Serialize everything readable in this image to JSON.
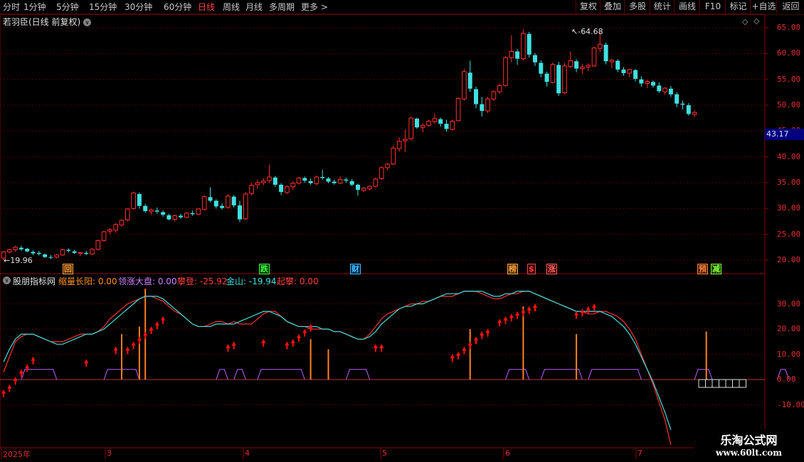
{
  "toolbar": {
    "periods": [
      "分时",
      "1分钟",
      "5分钟",
      "15分钟",
      "30分钟",
      "60分钟",
      "日线",
      "周线",
      "月线",
      "多周期",
      "更多 >"
    ],
    "active_period": "日线",
    "right_buttons": [
      "复权",
      "叠加",
      "多股",
      "统计",
      "画线",
      "F10",
      "标记",
      "+自选",
      "返回"
    ]
  },
  "main_panel": {
    "title": "若羽臣(日线 前复权)",
    "high_label": "64.68",
    "low_label": "19.96",
    "current_price": "43.17",
    "y_axis": [
      "65.00",
      "60.00",
      "55.00",
      "50.00",
      "45.00",
      "40.00",
      "35.00",
      "30.00",
      "25.00",
      "20.00"
    ],
    "events": [
      {
        "text": "回",
        "color": "#ffa040",
        "bg": "#402000"
      },
      {
        "text": "跌",
        "color": "#40ff40",
        "bg": "#003000"
      },
      {
        "text": "财",
        "color": "#40c0ff",
        "bg": "#002040"
      },
      {
        "text": "榜",
        "color": "#ffa040",
        "bg": "#403000"
      },
      {
        "text": "$",
        "color": "#ff4040",
        "bg": "#300000"
      },
      {
        "text": "涨",
        "color": "#ff6060",
        "bg": "#300000"
      },
      {
        "text": "预",
        "color": "#ff8040",
        "bg": "#402000"
      },
      {
        "text": "减",
        "color": "#80ff40",
        "bg": "#203000"
      }
    ]
  },
  "indicator_panel": {
    "title": "股朋指标网",
    "items": [
      {
        "label": "缩量长阳: 0.00",
        "color": "#ff9020"
      },
      {
        "label": "领涨大盘: 0.00",
        "color": "#d080ff"
      },
      {
        "label": "攀登: -25.92",
        "color": "#ff4040"
      },
      {
        "label": "金山: -19.94",
        "color": "#40e0e0"
      },
      {
        "label": "起攀: 0.00",
        "color": "#ff4040"
      }
    ],
    "y_axis": [
      "30.00",
      "20.00",
      "10.00",
      "0.00",
      "-10.00"
    ]
  },
  "date_axis": [
    "2025年",
    "3",
    "4",
    "5",
    "6",
    "7"
  ],
  "watermark": {
    "line1": "乐淘公式网",
    "line2": "www.60lt.com"
  },
  "colors": {
    "up": "#ff3030",
    "down": "#40e0e0",
    "grid": "#5a0000",
    "axis_text": "#e03030"
  },
  "chart_data": {
    "type": "candlestick",
    "candles": [
      [
        20.4,
        21.8,
        20.0,
        21.6
      ],
      [
        21.6,
        22.2,
        21.3,
        22.0
      ],
      [
        22.0,
        22.8,
        21.6,
        22.5
      ],
      [
        22.4,
        22.8,
        21.8,
        22.1
      ],
      [
        22.2,
        22.4,
        21.5,
        21.7
      ],
      [
        21.6,
        21.9,
        21.0,
        21.3
      ],
      [
        21.4,
        21.8,
        20.9,
        21.2
      ],
      [
        21.1,
        21.3,
        20.4,
        20.6
      ],
      [
        20.6,
        21.0,
        20.2,
        20.5
      ],
      [
        20.6,
        21.2,
        20.3,
        21.0
      ],
      [
        21.0,
        22.2,
        20.8,
        22.0
      ],
      [
        22.0,
        22.3,
        21.5,
        21.8
      ],
      [
        21.7,
        22.0,
        21.2,
        21.4
      ],
      [
        21.3,
        21.6,
        20.8,
        21.5
      ],
      [
        21.4,
        21.8,
        21.0,
        21.2
      ],
      [
        21.2,
        22.3,
        21.0,
        22.1
      ],
      [
        22.1,
        24.0,
        21.9,
        23.8
      ],
      [
        23.8,
        25.7,
        23.5,
        25.5
      ],
      [
        25.6,
        26.2,
        25.0,
        25.9
      ],
      [
        25.8,
        27.2,
        25.3,
        26.9
      ],
      [
        26.8,
        28.0,
        26.5,
        27.7
      ],
      [
        27.8,
        30.1,
        27.5,
        29.9
      ],
      [
        30.0,
        33.3,
        29.8,
        33.0
      ],
      [
        32.8,
        33.1,
        30.0,
        30.5
      ],
      [
        30.5,
        30.9,
        29.2,
        29.5
      ],
      [
        29.4,
        30.0,
        28.8,
        29.7
      ],
      [
        29.6,
        30.2,
        29.0,
        29.4
      ],
      [
        29.3,
        29.6,
        28.4,
        28.8
      ],
      [
        28.7,
        29.0,
        27.7,
        27.9
      ],
      [
        27.9,
        28.8,
        27.5,
        28.6
      ],
      [
        28.6,
        29.0,
        28.0,
        28.3
      ],
      [
        28.3,
        29.3,
        28.1,
        29.1
      ],
      [
        29.1,
        29.6,
        28.6,
        28.9
      ],
      [
        28.9,
        30.1,
        28.7,
        29.9
      ],
      [
        29.8,
        32.6,
        29.6,
        32.3
      ],
      [
        32.2,
        34.1,
        31.2,
        31.5
      ],
      [
        31.5,
        31.8,
        30.0,
        30.4
      ],
      [
        30.5,
        31.0,
        29.8,
        30.1
      ],
      [
        30.2,
        32.8,
        30.0,
        32.4
      ],
      [
        32.3,
        32.6,
        30.2,
        30.6
      ],
      [
        30.6,
        31.5,
        27.4,
        27.9
      ],
      [
        28.0,
        33.2,
        27.8,
        32.8
      ],
      [
        32.9,
        35.0,
        32.5,
        34.5
      ],
      [
        34.6,
        35.6,
        33.8,
        35.0
      ],
      [
        35.0,
        35.9,
        34.5,
        35.3
      ],
      [
        35.4,
        38.5,
        34.9,
        36.1
      ],
      [
        36.0,
        36.3,
        34.2,
        34.6
      ],
      [
        34.6,
        34.9,
        32.6,
        33.2
      ],
      [
        33.1,
        34.5,
        32.8,
        34.2
      ],
      [
        34.2,
        35.2,
        33.6,
        34.9
      ],
      [
        34.9,
        36.1,
        34.6,
        35.9
      ],
      [
        35.9,
        36.2,
        35.0,
        35.4
      ],
      [
        35.3,
        35.8,
        34.6,
        34.9
      ],
      [
        34.8,
        36.4,
        34.5,
        36.1
      ],
      [
        36.1,
        37.5,
        35.6,
        35.9
      ],
      [
        35.8,
        36.1,
        34.9,
        35.2
      ],
      [
        35.2,
        35.6,
        34.6,
        34.9
      ],
      [
        34.9,
        36.2,
        34.7,
        35.6
      ],
      [
        35.6,
        36.0,
        35.0,
        35.4
      ],
      [
        35.3,
        35.7,
        34.3,
        34.6
      ],
      [
        34.6,
        34.8,
        32.5,
        33.6
      ],
      [
        33.5,
        34.2,
        33.2,
        33.9
      ],
      [
        33.8,
        34.5,
        33.5,
        34.3
      ],
      [
        34.3,
        36.0,
        34.1,
        35.7
      ],
      [
        35.8,
        38.2,
        35.5,
        37.9
      ],
      [
        37.9,
        38.8,
        37.4,
        38.6
      ],
      [
        38.6,
        42.2,
        38.4,
        41.7
      ],
      [
        41.6,
        43.8,
        41.0,
        43.0
      ],
      [
        43.1,
        45.3,
        40.9,
        43.4
      ],
      [
        43.5,
        47.8,
        43.2,
        47.5
      ],
      [
        47.4,
        47.6,
        45.4,
        45.7
      ],
      [
        45.7,
        46.5,
        44.8,
        46.1
      ],
      [
        46.1,
        47.2,
        45.8,
        46.9
      ],
      [
        46.8,
        48.4,
        46.4,
        47.4
      ],
      [
        47.3,
        47.6,
        45.8,
        46.4
      ],
      [
        46.4,
        47.2,
        44.9,
        45.4
      ],
      [
        45.3,
        47.2,
        45.1,
        46.9
      ],
      [
        47.0,
        51.5,
        46.8,
        51.3
      ],
      [
        51.2,
        57.0,
        50.9,
        56.5
      ],
      [
        56.3,
        58.6,
        52.6,
        53.2
      ],
      [
        53.1,
        53.6,
        49.4,
        50.2
      ],
      [
        50.2,
        51.6,
        47.8,
        48.9
      ],
      [
        48.9,
        51.6,
        48.5,
        51.2
      ],
      [
        51.2,
        52.9,
        50.8,
        52.6
      ],
      [
        52.6,
        54.2,
        52.2,
        53.8
      ],
      [
        53.8,
        59.5,
        53.6,
        59.2
      ],
      [
        59.2,
        63.5,
        58.4,
        60.4
      ],
      [
        60.4,
        60.9,
        57.8,
        59.0
      ],
      [
        59.0,
        64.68,
        58.6,
        63.9
      ],
      [
        63.8,
        64.2,
        59.2,
        59.8
      ],
      [
        59.7,
        60.1,
        57.6,
        58.3
      ],
      [
        58.2,
        58.7,
        55.4,
        56.1
      ],
      [
        56.1,
        56.5,
        53.6,
        54.5
      ],
      [
        54.4,
        58.3,
        54.2,
        57.9
      ],
      [
        57.8,
        58.4,
        51.8,
        52.3
      ],
      [
        52.4,
        58.2,
        52.1,
        57.6
      ],
      [
        57.5,
        60.4,
        57.2,
        58.6
      ],
      [
        58.5,
        58.9,
        56.4,
        57.1
      ],
      [
        57.1,
        58.0,
        56.0,
        57.4
      ],
      [
        57.4,
        58.1,
        56.6,
        57.7
      ],
      [
        57.6,
        61.3,
        57.4,
        61.1
      ],
      [
        61.0,
        64.2,
        60.3,
        61.8
      ],
      [
        61.7,
        62.1,
        57.9,
        58.5
      ],
      [
        58.4,
        59.0,
        57.2,
        58.7
      ],
      [
        58.6,
        58.9,
        56.4,
        56.9
      ],
      [
        56.9,
        57.4,
        55.7,
        56.2
      ],
      [
        56.2,
        57.1,
        55.4,
        56.9
      ],
      [
        56.8,
        57.0,
        54.6,
        55.1
      ],
      [
        55.0,
        55.6,
        53.6,
        54.2
      ],
      [
        54.2,
        54.9,
        53.3,
        54.6
      ],
      [
        54.5,
        54.8,
        53.4,
        53.8
      ],
      [
        53.8,
        54.4,
        52.4,
        52.7
      ],
      [
        52.6,
        53.5,
        52.0,
        53.3
      ],
      [
        53.2,
        53.7,
        51.6,
        52.1
      ],
      [
        52.1,
        52.5,
        49.6,
        50.3
      ],
      [
        50.3,
        50.9,
        49.2,
        50.1
      ],
      [
        50.0,
        50.4,
        48.0,
        48.3
      ],
      [
        48.2,
        49.0,
        47.7,
        48.6
      ]
    ],
    "ind_red": [
      3,
      9,
      15,
      17,
      18,
      18,
      17,
      16,
      15,
      15,
      15,
      16,
      17,
      18,
      18,
      18,
      19,
      21,
      24,
      26,
      28,
      30,
      31,
      32,
      33,
      33,
      32,
      31,
      29,
      27,
      26,
      24,
      22,
      21,
      21,
      22,
      23,
      23,
      22,
      23,
      22,
      22,
      22,
      24,
      26,
      27,
      27,
      25,
      23,
      22,
      21,
      21,
      20,
      20,
      20,
      20,
      19,
      19,
      18,
      17,
      16,
      16,
      18,
      21,
      24,
      26,
      27,
      28,
      29,
      30,
      30,
      31,
      31,
      32,
      33,
      33,
      33,
      34,
      35,
      35,
      35,
      34,
      33,
      32,
      32,
      33,
      34,
      34,
      35,
      35,
      34,
      33,
      32,
      31,
      30,
      29,
      28,
      27,
      27,
      26,
      26,
      27,
      27,
      26,
      25,
      23,
      20,
      16,
      10,
      4,
      -2,
      -9,
      -16,
      -25.92
    ],
    "ind_cyan": [
      7,
      12,
      16,
      18,
      18,
      18,
      17,
      16,
      15,
      14,
      14,
      15,
      16,
      17,
      18,
      18,
      19,
      20,
      22,
      24,
      26,
      28,
      30,
      32,
      33,
      33,
      33,
      32,
      30,
      28,
      26,
      24,
      22,
      21,
      21,
      21,
      22,
      22,
      22,
      22,
      23,
      24,
      25,
      26,
      27,
      27,
      26,
      25,
      23,
      22,
      21,
      21,
      21,
      21,
      20,
      20,
      19,
      19,
      18,
      17,
      16,
      16,
      17,
      19,
      22,
      24,
      26,
      28,
      29,
      29,
      30,
      30,
      31,
      32,
      33,
      34,
      34,
      34,
      35,
      35,
      35,
      35,
      34,
      33,
      33,
      34,
      34,
      35,
      35,
      35,
      34,
      33,
      32,
      31,
      30,
      29,
      28,
      27,
      27,
      27,
      27,
      27,
      26,
      25,
      23,
      21,
      18,
      14,
      9,
      4,
      -1,
      -7,
      -13,
      -19.94
    ],
    "orange_bars": [
      [
        20,
        18
      ],
      [
        23,
        21
      ],
      [
        24,
        36
      ],
      [
        52,
        16
      ],
      [
        55,
        12
      ],
      [
        79,
        20
      ],
      [
        88,
        29
      ],
      [
        97,
        18
      ],
      [
        119,
        19
      ]
    ],
    "purple_regions": [
      [
        3,
        9
      ],
      [
        17,
        23
      ],
      [
        36,
        38
      ],
      [
        39,
        41
      ],
      [
        43,
        51
      ],
      [
        58,
        62
      ],
      [
        85,
        89
      ],
      [
        91,
        98
      ],
      [
        99,
        108
      ],
      [
        117,
        120
      ],
      [
        131,
        133
      ]
    ],
    "red_arrows": [
      [
        0,
        -5
      ],
      [
        1,
        -3
      ],
      [
        2,
        0
      ],
      [
        3,
        3
      ],
      [
        4,
        5
      ],
      [
        5,
        8
      ],
      [
        14,
        7
      ],
      [
        19,
        12
      ],
      [
        21,
        12
      ],
      [
        22,
        14
      ],
      [
        23,
        16
      ],
      [
        24,
        18
      ],
      [
        25,
        20
      ],
      [
        26,
        22
      ],
      [
        27,
        24
      ],
      [
        38,
        13
      ],
      [
        39,
        14
      ],
      [
        44,
        15
      ],
      [
        48,
        14
      ],
      [
        49,
        15
      ],
      [
        50,
        17
      ],
      [
        51,
        19
      ],
      [
        52,
        21
      ],
      [
        63,
        13
      ],
      [
        64,
        13
      ],
      [
        76,
        9
      ],
      [
        77,
        10
      ],
      [
        78,
        12
      ],
      [
        79,
        14
      ],
      [
        80,
        16
      ],
      [
        81,
        18
      ],
      [
        82,
        19
      ],
      [
        84,
        23
      ],
      [
        85,
        24
      ],
      [
        86,
        25
      ],
      [
        87,
        26
      ],
      [
        88,
        27
      ],
      [
        89,
        28
      ],
      [
        90,
        29
      ],
      [
        97,
        26
      ],
      [
        98,
        27
      ],
      [
        99,
        28
      ],
      [
        100,
        29
      ]
    ],
    "ind_ylim": [
      -20,
      40
    ],
    "ylim": [
      18,
      66
    ]
  }
}
